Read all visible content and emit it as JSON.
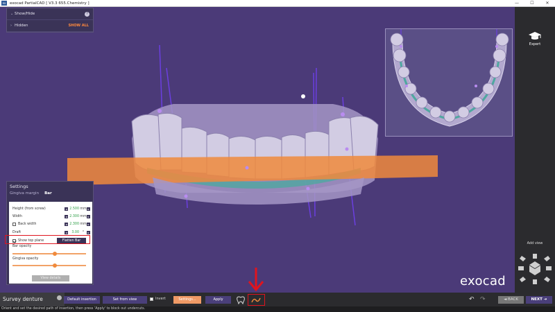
{
  "window": {
    "app_icon": "ex",
    "title": "exocad PartialCAD [ V3.3 655.Chemistry ]",
    "minimize": "—",
    "maximize": "☐",
    "close": "✕"
  },
  "showhide_panel": {
    "row1": {
      "label": "Show/Hide",
      "help": "?"
    },
    "row2": {
      "label": "Hidden",
      "action": "SHOW ALL"
    }
  },
  "sidebar": {
    "expert_label": "Expert",
    "add_view_label": "Add view"
  },
  "settings": {
    "title": "Settings",
    "tabs": [
      {
        "label": "Gingiva margin",
        "active": false
      },
      {
        "label": "Bar",
        "active": true
      }
    ],
    "fields": [
      {
        "label": "Height (from screw)",
        "value": "2.500",
        "unit": "mm"
      },
      {
        "label": "Width",
        "value": "2.300",
        "unit": "mm"
      },
      {
        "label": "Back width",
        "value": "2.300",
        "unit": "mm",
        "checked": false
      },
      {
        "label": "Draft",
        "value": "3.00",
        "unit": "°"
      }
    ],
    "show_top_plane": {
      "label": "Show top plane",
      "checked": true
    },
    "flatten_bar": "Flatten Bar",
    "bar_opacity": {
      "label": "Bar opacity",
      "level": 0.58
    },
    "gingiva_opacity": {
      "label": "Gingiva opacity",
      "level": 0.58
    },
    "view_details": "View details"
  },
  "brand": "exocad",
  "bottom": {
    "wizard_step": "Survey denture",
    "default_insertion": "Default insertion",
    "set_from_view": "Set from view",
    "invert": "Invert",
    "settings_btn": "Settings...",
    "apply": "Apply",
    "tool1_icon": "tooth-outline-icon",
    "tool2_icon": "curve-path-icon",
    "undo": "↶",
    "redo": "↷",
    "back": "◄ BACK",
    "next": "NEXT ➔"
  },
  "status": "Orient and set the desired path of insertion, then press 'Apply' to block out undercuts.",
  "colors": {
    "viewport_bg": "#4b3a78",
    "orange_accent": "#f08a3c",
    "highlight_red": "#e0141e",
    "green_value": "#2b9c44"
  }
}
